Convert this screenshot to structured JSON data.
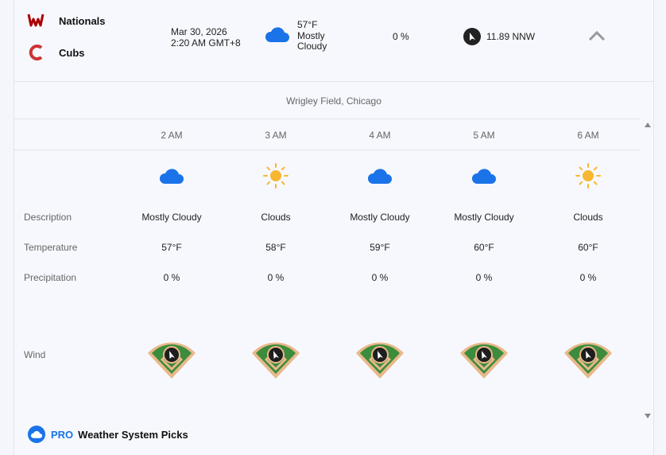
{
  "game": {
    "away_team": "Nationals",
    "home_team": "Cubs",
    "date": "Mar 30, 2026",
    "time": "2:20 AM GMT+8",
    "temperature": "57°F",
    "condition_line1": "Mostly",
    "condition_line2": "Cloudy",
    "condition_icon": "cloud-icon",
    "precipitation": "0 %",
    "wind": "11.89 NNW",
    "venue": "Wrigley Field, Chicago"
  },
  "colors": {
    "nationals_red": "#ab0003",
    "cubs_red": "#cc3433",
    "cloud_blue": "#1a73e8",
    "sun_yellow": "#f7b731",
    "field_green": "#3d8b3d",
    "infield_tan": "#e8b98a"
  },
  "labels": {
    "description": "Description",
    "temperature": "Temperature",
    "precipitation": "Precipitation",
    "wind": "Wind"
  },
  "hours": [
    {
      "time": "2 AM",
      "icon": "cloud-icon",
      "description": "Mostly Cloudy",
      "temperature": "57°F",
      "precipitation": "0 %"
    },
    {
      "time": "3 AM",
      "icon": "sun-icon",
      "description": "Clouds",
      "temperature": "58°F",
      "precipitation": "0 %"
    },
    {
      "time": "4 AM",
      "icon": "cloud-icon",
      "description": "Mostly Cloudy",
      "temperature": "59°F",
      "precipitation": "0 %"
    },
    {
      "time": "5 AM",
      "icon": "cloud-icon",
      "description": "Mostly Cloudy",
      "temperature": "60°F",
      "precipitation": "0 %"
    },
    {
      "time": "6 AM",
      "icon": "sun-icon",
      "description": "Clouds",
      "temperature": "60°F",
      "precipitation": "0 %"
    }
  ],
  "pro": {
    "badge": "PRO",
    "title": "Weather System Picks"
  }
}
